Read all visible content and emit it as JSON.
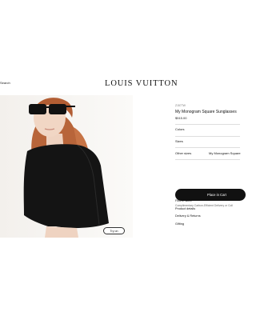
{
  "header": {
    "search_label": "Search",
    "brand": "LOUIS VUITTON"
  },
  "hero": {
    "image_alt": "Model wearing black monogram square sunglasses and black cape top",
    "try_on_label": "Try on"
  },
  "product": {
    "reference": "Z1577W",
    "name": "My Monogram Square Sunglasses",
    "price": "$515.00",
    "options": [
      {
        "label": "Colors",
        "value": ""
      },
      {
        "label": "Sizes",
        "value": ""
      },
      {
        "label": "Other sizes",
        "value": "My Monogram Square"
      }
    ],
    "cart_label": "Place in Cart",
    "delivery_note": "Complimentary Carbon-Efficient Delivery or Coll"
  },
  "links": [
    {
      "label": "Find in store"
    },
    {
      "label": "Product details"
    },
    {
      "label": "Delivery & Returns"
    },
    {
      "label": "Gifting"
    }
  ],
  "colors": {
    "accent": "#111111",
    "background": "#ffffff"
  }
}
